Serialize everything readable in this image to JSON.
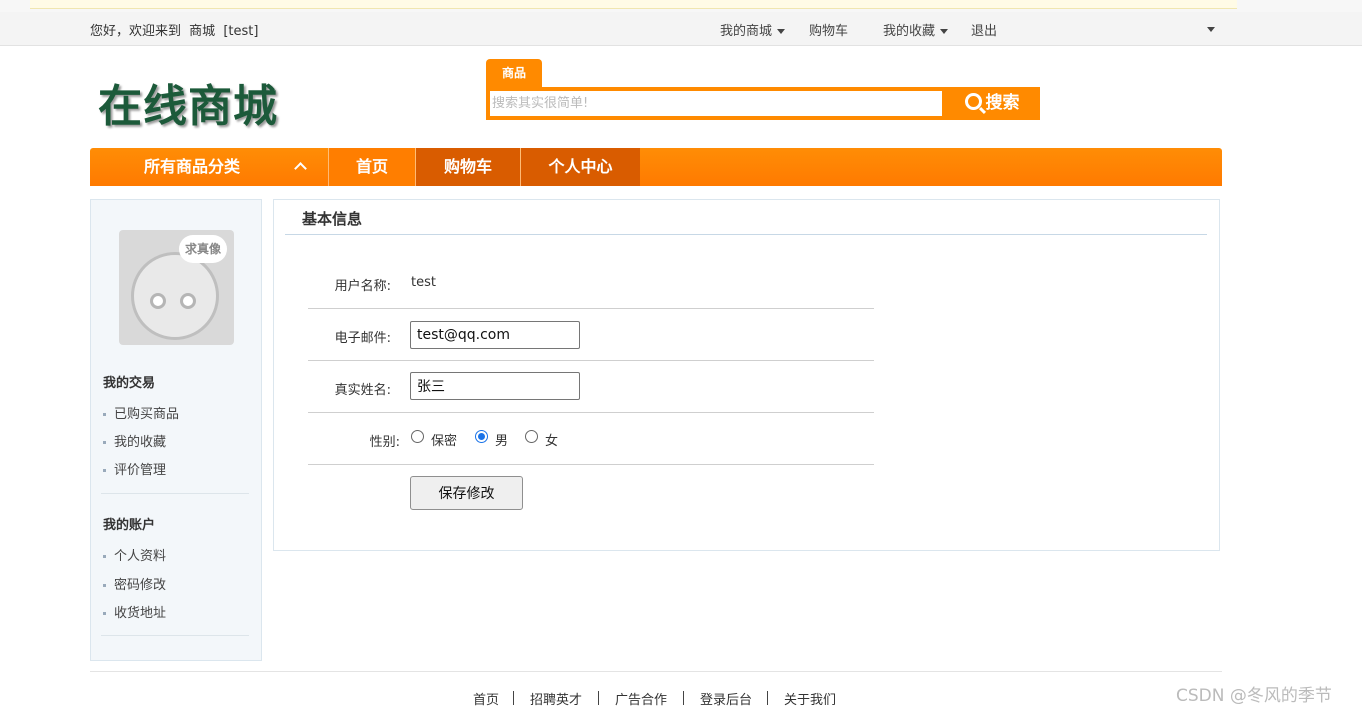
{
  "topbar": {
    "welcome": "您好，欢迎来到",
    "site_name": "商城",
    "username": "[test]",
    "links": {
      "my_mall": "我的商城",
      "cart": "购物车",
      "favorites": "我的收藏",
      "logout": "退出"
    }
  },
  "logo": {
    "text": "在线商城"
  },
  "search": {
    "tab": "商品",
    "placeholder": "搜索其实很简单!",
    "button": "搜索"
  },
  "nav": {
    "all_categories": "所有商品分类",
    "items": [
      "首页",
      "购物车",
      "个人中心"
    ]
  },
  "sidebar": {
    "avatar_bubble": "求真像",
    "trade": {
      "heading": "我的交易",
      "items": [
        "已购买商品",
        "我的收藏",
        "评价管理"
      ]
    },
    "account": {
      "heading": "我的账户",
      "items": [
        "个人资料",
        "密码修改",
        "收货地址"
      ]
    }
  },
  "profile": {
    "title": "基本信息",
    "username_label": "用户名称:",
    "username_value": "test",
    "email_label": "电子邮件:",
    "email_value": "test@qq.com",
    "realname_label": "真实姓名:",
    "realname_value": "张三",
    "gender_label": "性别:",
    "gender_options": [
      "保密",
      "男",
      "女"
    ],
    "gender_selected": "男",
    "save_button": "保存修改"
  },
  "footer": {
    "links": [
      "首页",
      "招聘英才",
      "广告合作",
      "登录后台",
      "关于我们"
    ]
  },
  "watermark": "CSDN @冬风的季节",
  "colors": {
    "accent": "#ff8a00",
    "nav_active": "#d95c00",
    "logo": "#1c5a3a"
  }
}
